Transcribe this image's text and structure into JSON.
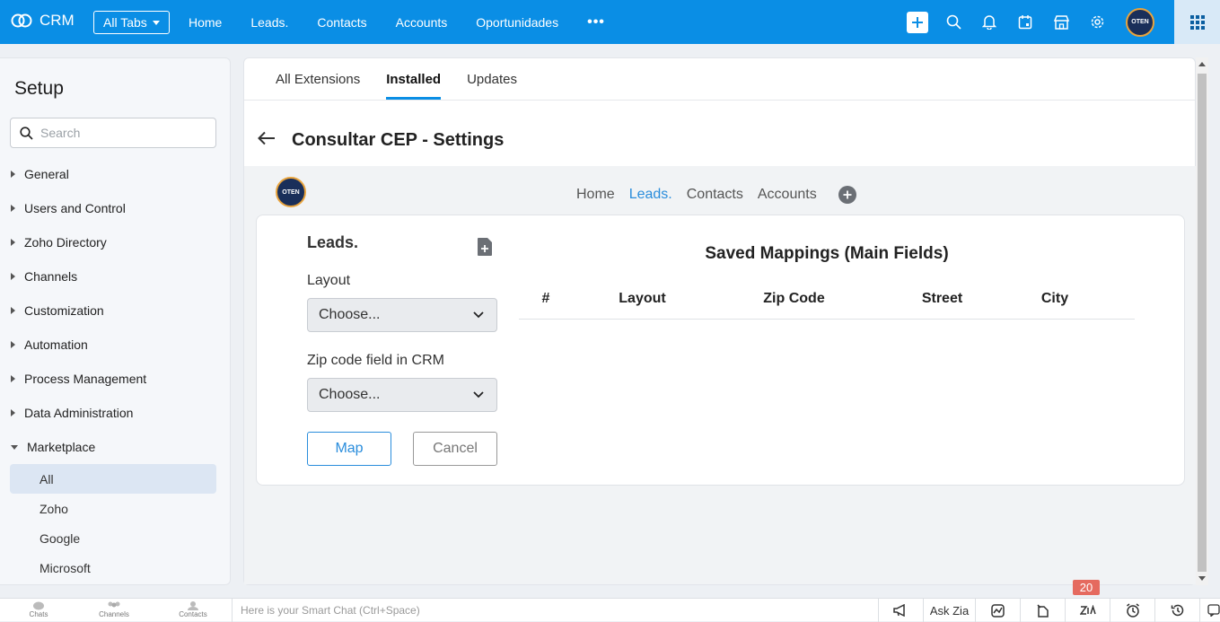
{
  "topbar": {
    "app_name": "CRM",
    "all_tabs_label": "All Tabs",
    "nav": [
      "Home",
      "Leads.",
      "Contacts",
      "Accounts",
      "Oportunidades"
    ],
    "more": "•••",
    "avatar_text": "OTEN"
  },
  "sidebar": {
    "title": "Setup",
    "search_placeholder": "Search",
    "items": [
      {
        "label": "General"
      },
      {
        "label": "Users and Control"
      },
      {
        "label": "Zoho Directory"
      },
      {
        "label": "Channels"
      },
      {
        "label": "Customization"
      },
      {
        "label": "Automation"
      },
      {
        "label": "Process Management"
      },
      {
        "label": "Data Administration"
      },
      {
        "label": "Marketplace"
      }
    ],
    "marketplace_sub": [
      "All",
      "Zoho",
      "Google",
      "Microsoft"
    ]
  },
  "tabs": [
    "All Extensions",
    "Installed",
    "Updates"
  ],
  "page_title": "Consultar CEP - Settings",
  "extension": {
    "logo_text": "OTEN",
    "nav": [
      "Home",
      "Leads.",
      "Contacts",
      "Accounts"
    ],
    "form": {
      "title": "Leads.",
      "layout_label": "Layout",
      "layout_value": "Choose...",
      "zip_label": "Zip code field in CRM",
      "zip_value": "Choose...",
      "map_button": "Map",
      "cancel_button": "Cancel"
    },
    "mappings": {
      "title": "Saved Mappings (Main Fields)",
      "columns": [
        "#",
        "Layout",
        "Zip Code",
        "Street",
        "City"
      ]
    }
  },
  "bottombar": {
    "chats": "Chats",
    "channels": "Channels",
    "contacts": "Contacts",
    "smart_chat_placeholder": "Here is your Smart Chat (Ctrl+Space)",
    "ask_zia": "Ask Zia",
    "notification_count": "20"
  },
  "colors": {
    "topbar": "#0a8ee5",
    "accent": "#2a8ddc",
    "badge": "#e56a5f"
  }
}
